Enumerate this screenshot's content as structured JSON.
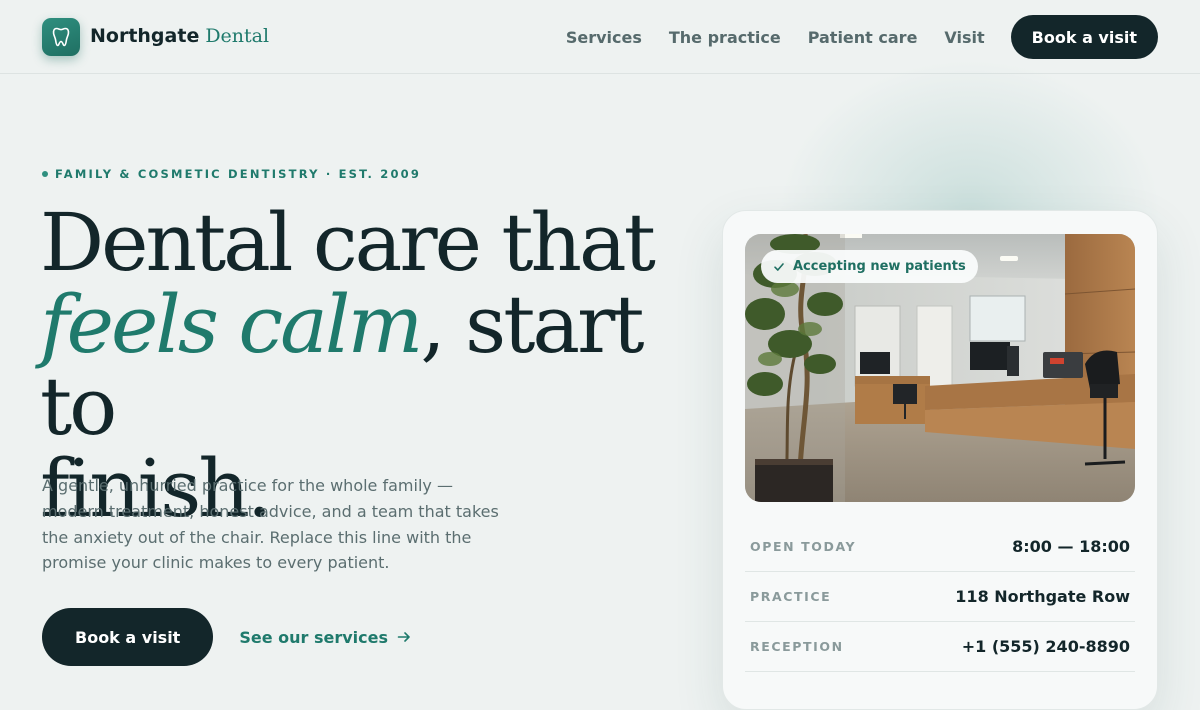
{
  "brand": {
    "name": "Northgate",
    "suffix": "Dental",
    "logo_icon": "tooth-icon"
  },
  "nav": {
    "links": [
      "Services",
      "The practice",
      "Patient care",
      "Visit"
    ],
    "cta_label": "Book a visit"
  },
  "hero": {
    "eyebrow": "FAMILY & COSMETIC DENTISTRY · EST. 2009",
    "headline_line1": "Dental care that",
    "headline_emphasis": "feels calm",
    "headline_rest": ", start to",
    "headline_line3": "finish.",
    "intro": "A gentle, unhurried practice for the whole family — modern treatment, honest advice, and a team that takes the anxiety out of the chair. Replace this line with the promise your clinic makes to every patient.",
    "primary_cta": "Book a visit",
    "secondary_cta": "See our services",
    "secondary_icon": "arrow-right-icon"
  },
  "card": {
    "badge": "Accepting new patients",
    "badge_icon": "check-icon",
    "rows": [
      {
        "label": "OPEN TODAY",
        "value": "8:00 — 18:00"
      },
      {
        "label": "PRACTICE",
        "value": "118 Northgate Row"
      },
      {
        "label": "RECEPTION",
        "value": "+1 (555) 240-8890"
      }
    ]
  },
  "colors": {
    "accent": "#1f7a6c",
    "dark": "#13262a",
    "background": "#eef2f1",
    "muted_text": "#5b6e70"
  }
}
